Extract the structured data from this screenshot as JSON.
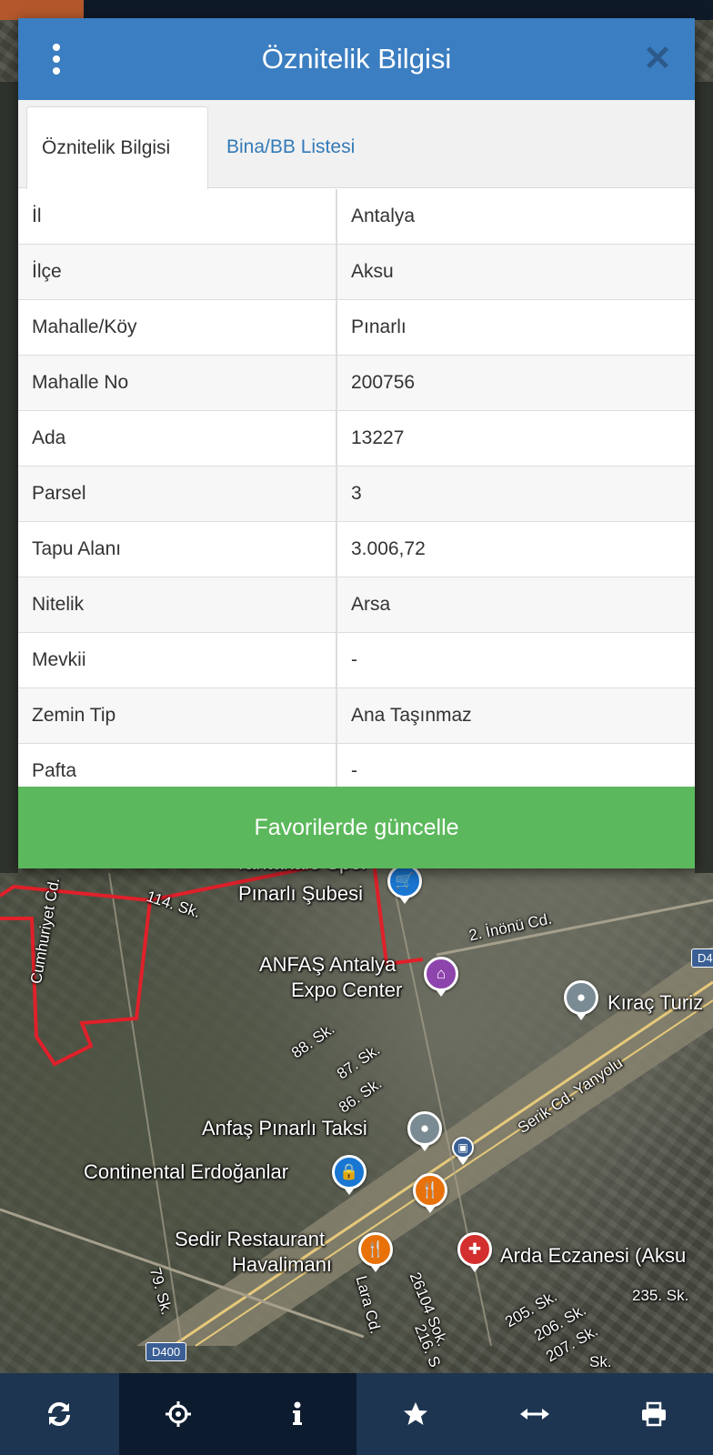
{
  "modal": {
    "title": "Öznitelik Bilgisi",
    "tabs": [
      {
        "label": "Öznitelik Bilgisi",
        "active": true
      },
      {
        "label": "Bina/BB Listesi",
        "active": false
      }
    ],
    "rows": [
      {
        "key": "İl",
        "value": "Antalya"
      },
      {
        "key": "İlçe",
        "value": "Aksu"
      },
      {
        "key": "Mahalle/Köy",
        "value": "Pınarlı"
      },
      {
        "key": "Mahalle No",
        "value": "200756"
      },
      {
        "key": "Ada",
        "value": "13227"
      },
      {
        "key": "Parsel",
        "value": "3"
      },
      {
        "key": "Tapu Alanı",
        "value": "3.006,72"
      },
      {
        "key": "Nitelik",
        "value": "Arsa"
      },
      {
        "key": "Mevkii",
        "value": "-"
      },
      {
        "key": "Zemin Tip",
        "value": "Ana Taşınmaz"
      },
      {
        "key": "Pafta",
        "value": "-"
      }
    ],
    "favorite_button": "Favorilerde güncelle",
    "icons": {
      "menu": "vertical-dots-icon",
      "close": "close-icon"
    }
  },
  "map": {
    "labels": {
      "tantakale": "Tantakale Spor",
      "pinarli_subesi": "Pınarlı Şubesi",
      "sk114": "114. Sk.",
      "cumhuriyet": "Cumhuriyet Cd.",
      "inonu": "2. İnönü Cd.",
      "anfas": "ANFAŞ Antalya",
      "expo": "Expo Center",
      "kirac": "Kıraç Turiz",
      "sk88": "88. Sk.",
      "sk87": "87. Sk.",
      "sk86": "86. Sk.",
      "serik": "Serik Cd. Yanyolu",
      "taksi": "Anfaş Pınarlı Taksi",
      "continental": "Continental Erdoğanlar",
      "sedir1": "Sedir Restaurant",
      "sedir2": "Havalimanı",
      "arda": "Arda Eczanesi (Aksu",
      "sk79": "79. Sk.",
      "lara": "Lara Cd.",
      "sk26104": "26104 Sok.",
      "sk216": "216. S",
      "sk205": "205. Sk.",
      "sk206": "206. Sk.",
      "sk207": "207. Sk.",
      "sk235": "235. Sk.",
      "sk_end": "Sk.",
      "d400": "D400",
      "d4": "D4"
    },
    "poi_icons": [
      "shopping-cart-icon",
      "museum-icon",
      "place-icon",
      "place-icon",
      "lock-icon",
      "restaurant-icon",
      "restaurant-icon",
      "pharmacy-icon",
      "transit-icon"
    ],
    "colors": {
      "boundary": "#e0202a",
      "cart": "#1976d2",
      "museum": "#8e44ad",
      "food": "#e8710a",
      "pharmacy": "#d32f2f",
      "place": "#7b8b93"
    }
  },
  "toolbar": {
    "buttons": [
      {
        "icon": "refresh-icon"
      },
      {
        "icon": "crosshair-icon"
      },
      {
        "icon": "info-icon"
      },
      {
        "icon": "star-icon"
      },
      {
        "icon": "measure-icon"
      },
      {
        "icon": "print-icon"
      }
    ]
  },
  "colors": {
    "header": "#3b7ec1",
    "tab_link": "#337ab7",
    "success": "#5cb85c",
    "toolbar_light": "#1d3551",
    "toolbar_dark": "#0d1b2e"
  }
}
